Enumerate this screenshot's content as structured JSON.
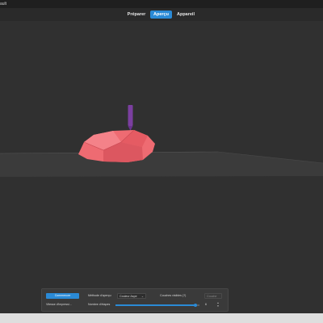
{
  "window": {
    "title": "ault"
  },
  "stages": [
    {
      "label": "Préparer",
      "active": false
    },
    {
      "label": "Aperçu",
      "active": true
    },
    {
      "label": "Appareil",
      "active": false
    }
  ],
  "viewport": {
    "background": "#303030",
    "model_color": "#ee6b72",
    "nozzle_color": "#7b3fa0",
    "bed_color": "#3b3b3b"
  },
  "preview_panel": {
    "primary_button": "Commencer",
    "method_label": "Méthode d'aperçu",
    "method_value": "Couleur Aspe",
    "layers_label": "Couches visibles (?)",
    "layers_value": "Couche",
    "secondary_label": "Vitesse d'impressi...",
    "slider_label": "Nombre d'étapes",
    "slider_value": "6",
    "slider_fraction": 0.95
  },
  "colors": {
    "accent": "#2a8ad6"
  }
}
